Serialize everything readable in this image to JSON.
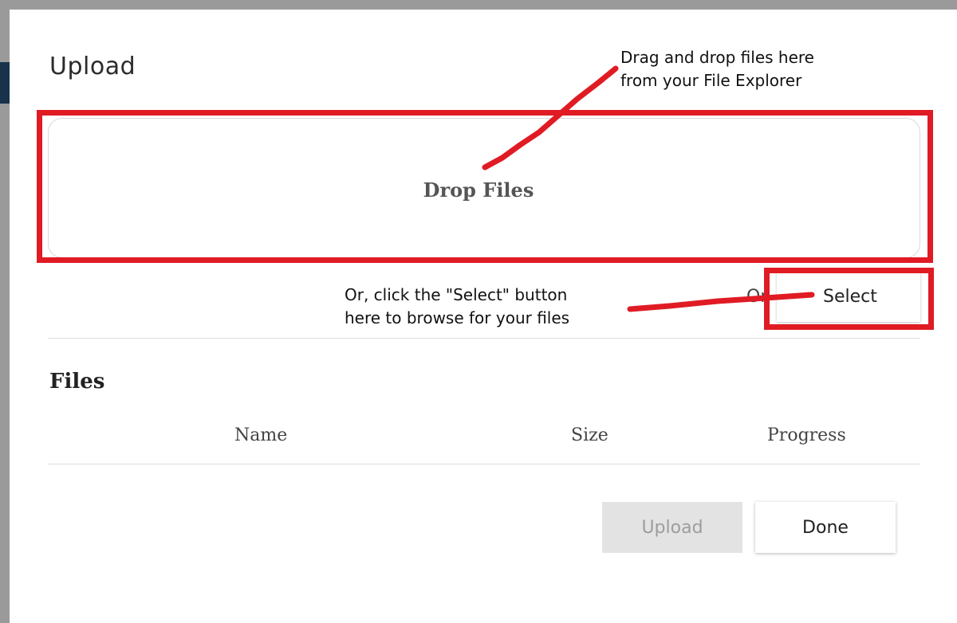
{
  "dialog": {
    "title": "Upload",
    "drop_zone_label": "Drop Files",
    "or_text": "Or",
    "select_button_label": "Select",
    "files_heading": "Files",
    "columns": [
      "Name",
      "Size",
      "Progress"
    ],
    "upload_button_label": "Upload",
    "done_button_label": "Done"
  },
  "annotations": {
    "drag_drop_note": [
      "Drag and drop files here",
      "from your File Explorer"
    ],
    "select_note": [
      "Or, click the \"Select\" button",
      "here to browse for your files"
    ],
    "highlight_color": "#e01b24"
  },
  "colors": {
    "backdrop": "#9a9a9a",
    "backdrop_strip": "#17324a",
    "disabled_button": "#e3e3e3"
  }
}
